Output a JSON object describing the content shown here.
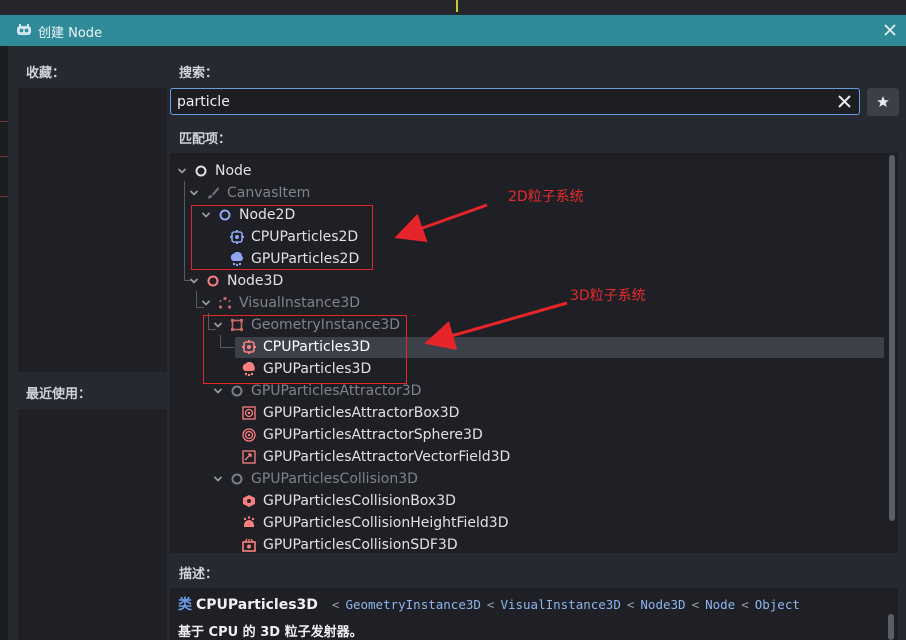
{
  "window": {
    "title": "创建 Node"
  },
  "favorites": {
    "label": "收藏："
  },
  "recent": {
    "label": "最近使用："
  },
  "search": {
    "label": "搜索：",
    "value": "particle",
    "placeholder": ""
  },
  "matches": {
    "label": "匹配项："
  },
  "tree": [
    {
      "label": "Node",
      "depth": 0,
      "expanded": true,
      "dim": false,
      "icon": "circle-node-icon",
      "color": "#e0e0e0"
    },
    {
      "label": "CanvasItem",
      "depth": 1,
      "expanded": true,
      "dim": true,
      "icon": "brush-icon",
      "color": "#8a8f98"
    },
    {
      "label": "Node2D",
      "depth": 2,
      "expanded": true,
      "dim": false,
      "icon": "circle-node2d-icon",
      "color": "#8da5f3"
    },
    {
      "label": "CPUParticles2D",
      "depth": 3,
      "expanded": null,
      "dim": false,
      "icon": "cpu-particles-2d-icon",
      "color": "#8da5f3"
    },
    {
      "label": "GPUParticles2D",
      "depth": 3,
      "expanded": null,
      "dim": false,
      "icon": "gpu-particles-2d-icon",
      "color": "#8da5f3"
    },
    {
      "label": "Node3D",
      "depth": 1,
      "expanded": true,
      "dim": false,
      "icon": "circle-node3d-icon",
      "color": "#fc7f7f"
    },
    {
      "label": "VisualInstance3D",
      "depth": 2,
      "expanded": true,
      "dim": true,
      "icon": "visual-instance-icon",
      "color": "#fc7f7f"
    },
    {
      "label": "GeometryInstance3D",
      "depth": 3,
      "expanded": true,
      "dim": true,
      "icon": "geometry-instance-icon",
      "color": "#fc7f7f"
    },
    {
      "label": "CPUParticles3D",
      "depth": 4,
      "expanded": null,
      "dim": false,
      "icon": "cpu-particles-3d-icon",
      "color": "#fc7f7f",
      "selected": true
    },
    {
      "label": "GPUParticles3D",
      "depth": 4,
      "expanded": null,
      "dim": false,
      "icon": "gpu-particles-3d-icon",
      "color": "#fc7f7f"
    },
    {
      "label": "GPUParticlesAttractor3D",
      "depth": 3,
      "expanded": true,
      "dim": true,
      "icon": "circle-attractor-icon",
      "color": "#9aa0aa"
    },
    {
      "label": "GPUParticlesAttractorBox3D",
      "depth": 4,
      "expanded": null,
      "dim": false,
      "icon": "attractor-box-icon",
      "color": "#fc7f7f"
    },
    {
      "label": "GPUParticlesAttractorSphere3D",
      "depth": 4,
      "expanded": null,
      "dim": false,
      "icon": "attractor-sphere-icon",
      "color": "#fc7f7f"
    },
    {
      "label": "GPUParticlesAttractorVectorField3D",
      "depth": 4,
      "expanded": null,
      "dim": false,
      "icon": "attractor-vectorfield-icon",
      "color": "#fc7f7f"
    },
    {
      "label": "GPUParticlesCollision3D",
      "depth": 3,
      "expanded": true,
      "dim": true,
      "icon": "circle-collision-icon",
      "color": "#9aa0aa"
    },
    {
      "label": "GPUParticlesCollisionBox3D",
      "depth": 4,
      "expanded": null,
      "dim": false,
      "icon": "collision-box-icon",
      "color": "#fc7f7f"
    },
    {
      "label": "GPUParticlesCollisionHeightField3D",
      "depth": 4,
      "expanded": null,
      "dim": false,
      "icon": "collision-heightfield-icon",
      "color": "#fc7f7f"
    },
    {
      "label": "GPUParticlesCollisionSDF3D",
      "depth": 4,
      "expanded": null,
      "dim": false,
      "icon": "collision-sdf-icon",
      "color": "#fc7f7f"
    }
  ],
  "annotations": {
    "label_2d": "2D粒子系统",
    "label_3d": "3D粒子系统",
    "color": "#e5252a"
  },
  "description": {
    "label": "描述：",
    "keyword": "类",
    "class_name": "CPUParticles3D",
    "inheritance": [
      "GeometryInstance3D",
      "VisualInstance3D",
      "Node3D",
      "Node",
      "Object"
    ],
    "separator": "<",
    "text": "基于 CPU 的 3D 粒子发射器。"
  },
  "colors": {
    "accent": "#699ce8",
    "titlebar": "#2f8b99",
    "node2d": "#8da5f3",
    "node3d": "#fc7f7f"
  }
}
